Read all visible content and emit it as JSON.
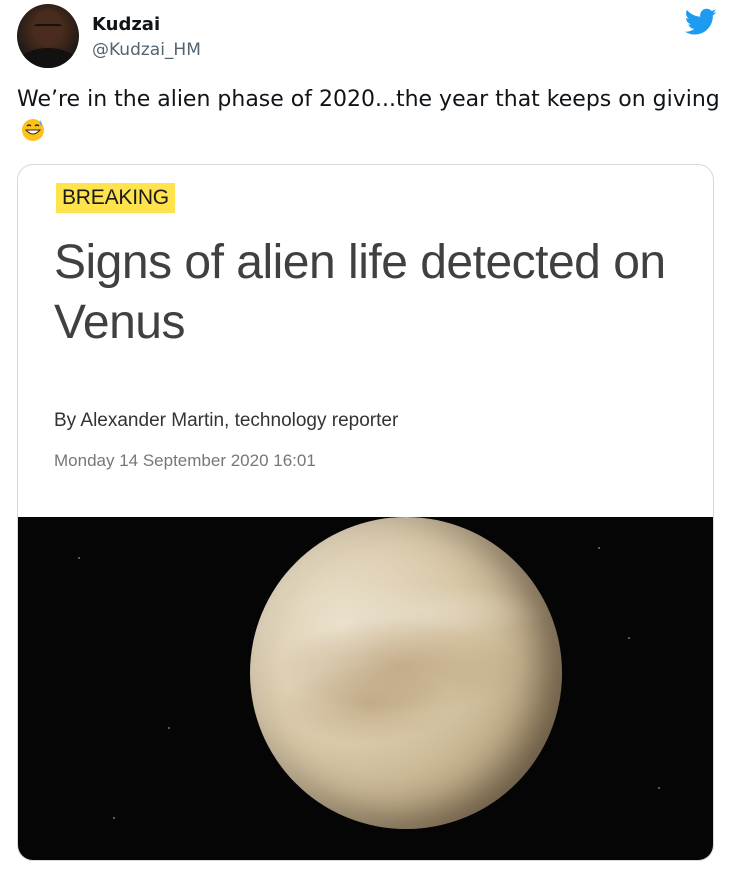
{
  "tweet": {
    "author_name": "Kudzai",
    "author_handle": "@Kudzai_HM",
    "text": "We’re in the alien phase of 2020...the year that keeps on giving",
    "emoji": "grinning-face-with-sweat"
  },
  "card": {
    "badge": "BREAKING",
    "headline": "Signs of alien life detected on Venus",
    "byline": "By Alexander Martin, technology reporter",
    "date": "Monday 14 September 2020 16:01"
  },
  "icons": {
    "brand": "twitter-bird-icon"
  },
  "colors": {
    "twitter_blue": "#1d9bf0",
    "badge_yellow": "#ffe34d",
    "handle_gray": "#536471"
  }
}
